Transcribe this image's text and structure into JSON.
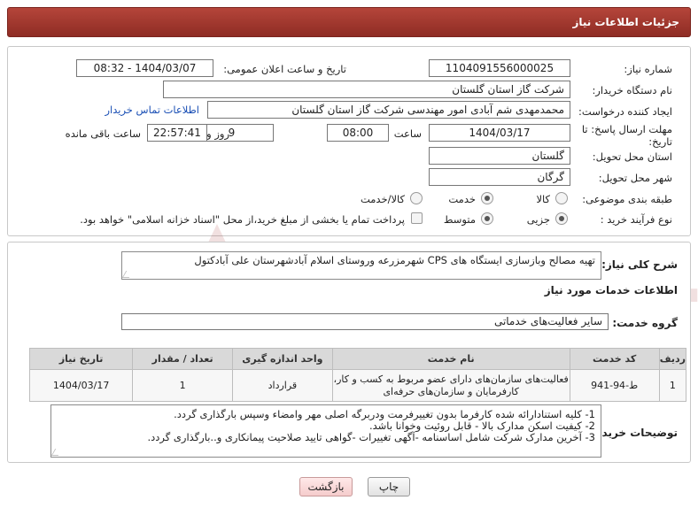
{
  "header": {
    "title": "جزئیات اطلاعات نیاز"
  },
  "form": {
    "need_number_label": "شماره نیاز:",
    "need_number": "1104091556000025",
    "announce_label": "تاریخ و ساعت اعلان عمومی:",
    "announce_value": "1404/03/07 - 08:32",
    "buyer_org_label": "نام دستگاه خریدار:",
    "buyer_org": "شرکت گاز استان گلستان",
    "creator_label": "ایجاد کننده درخواست:",
    "creator": "محمدمهدی شم آبادی امور مهندسی شرکت گاز استان گلستان",
    "contact_link": "اطلاعات تماس خریدار",
    "deadline_label_1": "مهلت ارسال پاسخ: تا",
    "deadline_label_2": "تاریخ:",
    "deadline_date": "1404/03/17",
    "time_label": "ساعت",
    "deadline_time": "08:00",
    "days_value": "9",
    "days_label": "روز و",
    "remaining_time": "22:57:41",
    "remaining_label": "ساعت باقی مانده",
    "province_label": "استان محل تحویل:",
    "province": "گلستان",
    "city_label": "شهر محل تحویل:",
    "city": "گرگان",
    "category_label": "طبقه بندی موضوعی:",
    "category_options": [
      "کالا",
      "خدمت",
      "کالا/خدمت"
    ],
    "category_selected": "خدمت",
    "process_label": "نوع فرآیند خرید :",
    "process_options": [
      "جزیی",
      "متوسط"
    ],
    "process_selected": "جزیی",
    "payment_note": "پرداخت تمام یا بخشی از مبلغ خرید،از محل \"اسناد خزانه اسلامی\" خواهد بود."
  },
  "need": {
    "summary_label": "شرح کلی نیاز:",
    "summary": "تهیه مصالح وبازسازی ایستگاه های CPS شهرمزرعه وروستای اسلام آبادشهرستان علی آبادکتول",
    "services_title": "اطلاعات خدمات مورد نیاز",
    "service_group_label": "گروه خدمت:",
    "service_group": "سایر فعالیت‌های خدماتی"
  },
  "table": {
    "headers": [
      "ردیف",
      "کد خدمت",
      "نام خدمت",
      "واحد اندازه گیری",
      "تعداد / مقدار",
      "تاریخ نیاز"
    ],
    "rows": [
      {
        "index": "1",
        "code": "ط-94-941",
        "name_line1": "فعالیت‌های سازمان‌های دارای عضو مربوط به کسب و کار،",
        "name_line2": "کارفرمایان و سازمان‌های حرفه‌ای",
        "unit": "قرارداد",
        "qty": "1",
        "date": "1404/03/17"
      }
    ]
  },
  "buyer_notes": {
    "label": "توضیحات خریدار:",
    "lines": [
      "1-    کلیه استنادارائه شده کارفرما بدون تغییرفرمت ودربرگه اصلی مهر وامضاء وسپس بارگذاری گردد.",
      "2-    کیفیت اسکن مدارک بالا - قابل روئیت وخوانا باشد.",
      "3-    آخرین مدارک شرکت شامل اساسنامه -آگهی تغییرات -گواهی تایید صلاحیت پیمانکاری و..بارگذاری گردد."
    ]
  },
  "buttons": {
    "print": "چاپ",
    "back": "بازگشت"
  },
  "watermark": {
    "text": "AriaTender.net"
  }
}
